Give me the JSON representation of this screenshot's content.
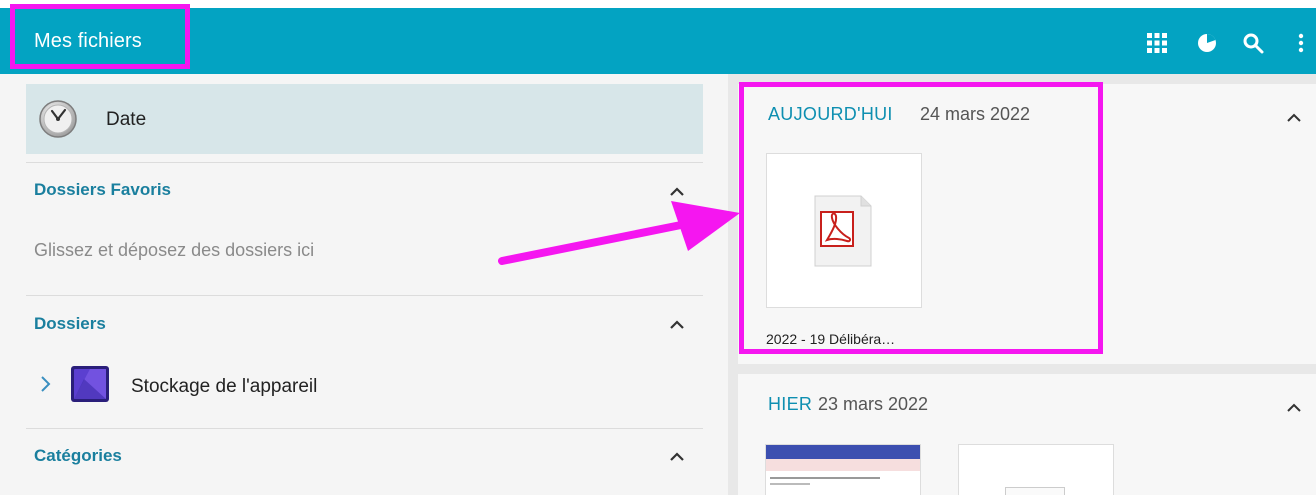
{
  "app": {
    "title": "Mes fichiers"
  },
  "toolbar": {
    "icons": [
      "grid-view-icon",
      "storage-usage-icon",
      "search-icon",
      "more-options-icon"
    ]
  },
  "sidebar": {
    "sort": {
      "label": "Date",
      "icon": "clock-icon"
    },
    "favorites": {
      "title": "Dossiers Favoris",
      "placeholder": "Glissez et déposez des dossiers ici"
    },
    "folders": {
      "title": "Dossiers",
      "items": [
        {
          "label": "Stockage de l'appareil",
          "icon": "device-storage-icon"
        }
      ]
    },
    "categories": {
      "title": "Catégories"
    }
  },
  "main": {
    "groups": [
      {
        "label": "AUJOURD'HUI",
        "date": "24 mars 2022",
        "files": [
          {
            "name": "2022 - 19 Délibéra…",
            "icon": "pdf-icon"
          }
        ]
      },
      {
        "label": "HIER",
        "date": "23 mars 2022",
        "files": []
      }
    ]
  },
  "colors": {
    "app_bar": "#03a3c2",
    "accent_text": "#1a7f9e",
    "annotation": "#f516f0",
    "selected_row": "#d7e6e9"
  }
}
